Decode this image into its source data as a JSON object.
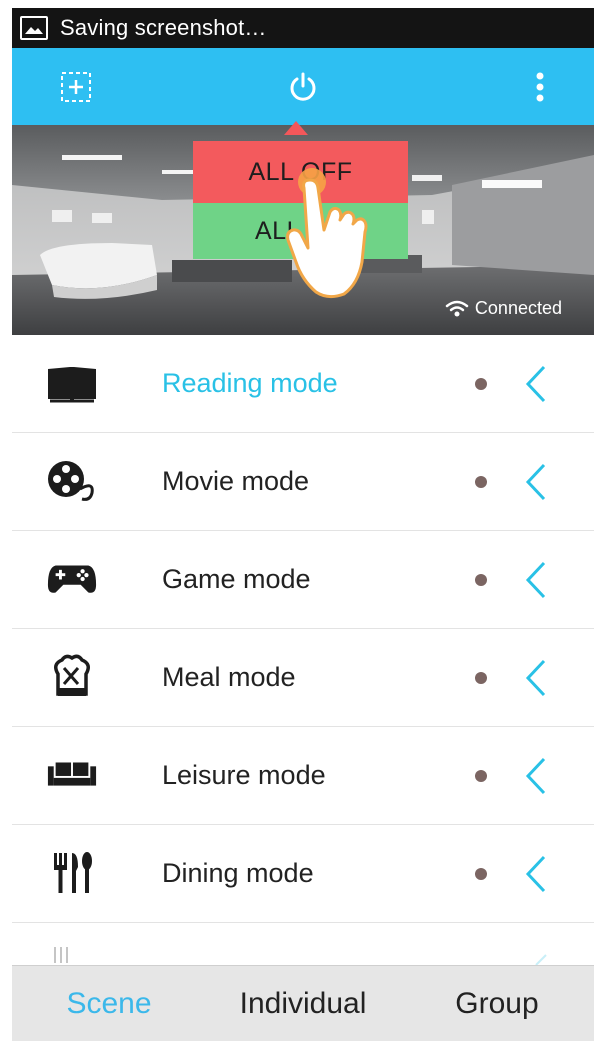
{
  "status_bar": {
    "text": "Saving screenshot…",
    "icon": "image-icon"
  },
  "action_bar": {
    "color": "#2ebff2",
    "left_icon": "add-device-icon",
    "center_icon": "power-icon",
    "right_icon": "overflow-menu-icon"
  },
  "popup": {
    "all_off": "ALL OFF",
    "all_on": "ALL ON",
    "off_color": "#f35a5d",
    "on_color": "#6fd387"
  },
  "connection": {
    "status": "Connected",
    "icon": "wifi-icon"
  },
  "scenes": [
    {
      "label": "Reading mode",
      "icon": "book-icon",
      "active": true
    },
    {
      "label": "Movie mode",
      "icon": "film-reel-icon",
      "active": false
    },
    {
      "label": "Game mode",
      "icon": "gamepad-icon",
      "active": false
    },
    {
      "label": "Meal mode",
      "icon": "chef-icon",
      "active": false
    },
    {
      "label": "Leisure mode",
      "icon": "sofa-icon",
      "active": false
    },
    {
      "label": "Dining mode",
      "icon": "cutlery-icon",
      "active": false
    }
  ],
  "tabs": [
    {
      "label": "Scene",
      "active": true
    },
    {
      "label": "Individual",
      "active": false
    },
    {
      "label": "Group",
      "active": false
    }
  ],
  "accent_color": "#29c1e6"
}
